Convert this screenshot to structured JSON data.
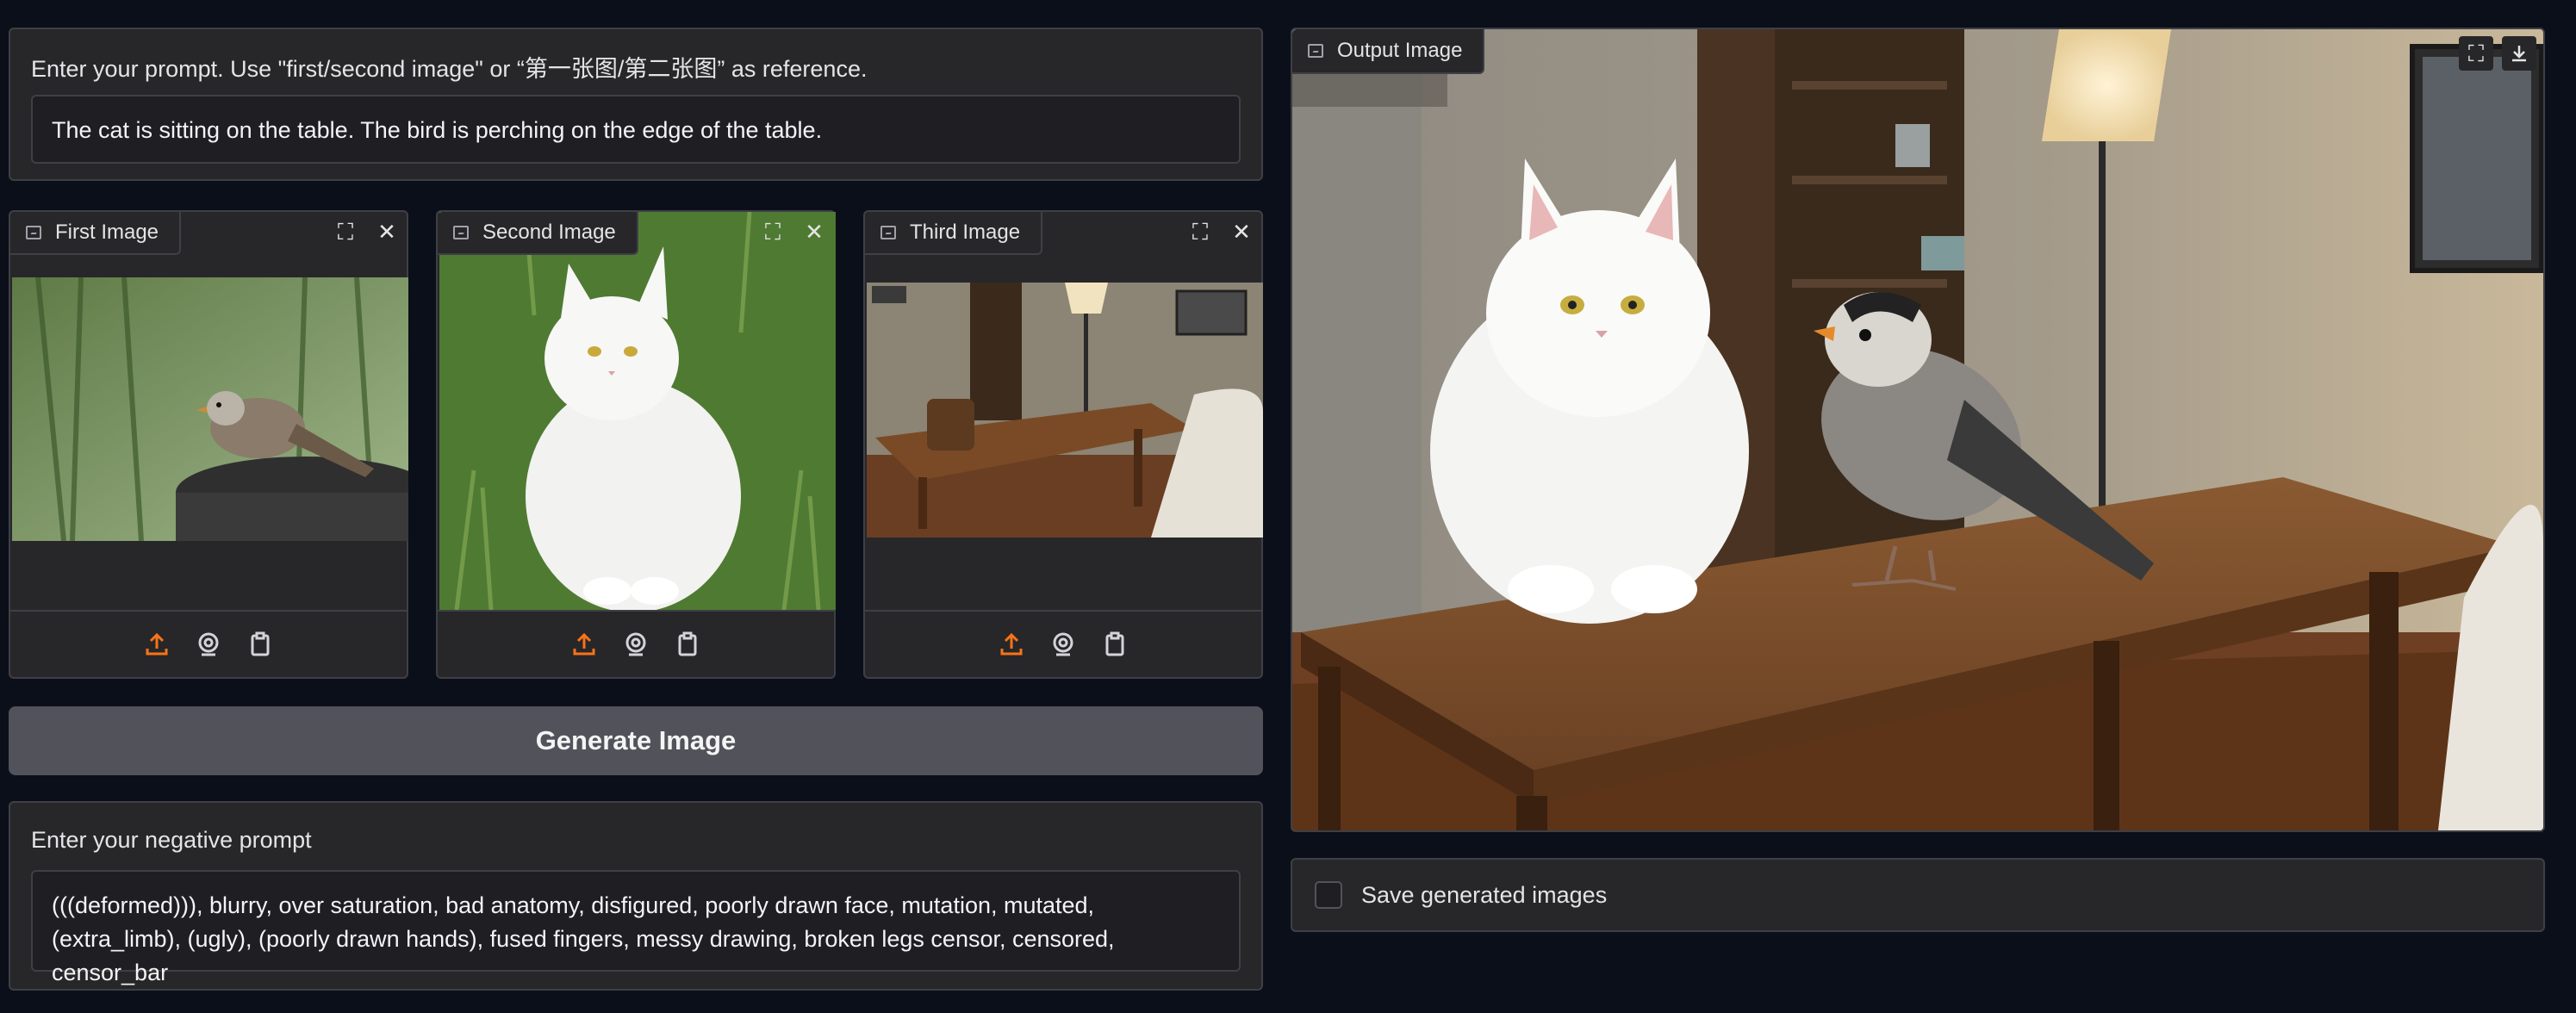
{
  "prompt": {
    "label": "Enter your prompt. Use \"first/second image\" or “第一张图/第二张图” as reference.",
    "value": "The cat is sitting on the table. The bird is perching on the edge of the table."
  },
  "inputs": [
    {
      "label": "First Image",
      "subject": "sparrow on a dark round table"
    },
    {
      "label": "Second Image",
      "subject": "white fluffy cat sitting on grass"
    },
    {
      "label": "Third Image",
      "subject": "wooden table in a room"
    }
  ],
  "generate_button": "Generate Image",
  "negative": {
    "label": "Enter your negative prompt",
    "value": "(((deformed))), blurry, over saturation, bad anatomy, disfigured, poorly drawn face, mutation, mutated, (extra_limb), (ugly), (poorly drawn hands), fused fingers, messy drawing, broken legs censor, censored, censor_bar"
  },
  "output": {
    "label": "Output Image"
  },
  "save_checkbox": {
    "label": "Save generated images",
    "checked": false
  },
  "icons": {
    "image": "image-icon",
    "fullscreen": "fullscreen-icon",
    "close": "close-icon",
    "upload": "upload-icon",
    "webcam": "webcam-icon",
    "clipboard": "clipboard-icon",
    "download": "download-icon"
  },
  "colors": {
    "background": "#0b0f19",
    "panel": "#27272a",
    "accent": "#f97316",
    "button": "#52525b"
  }
}
